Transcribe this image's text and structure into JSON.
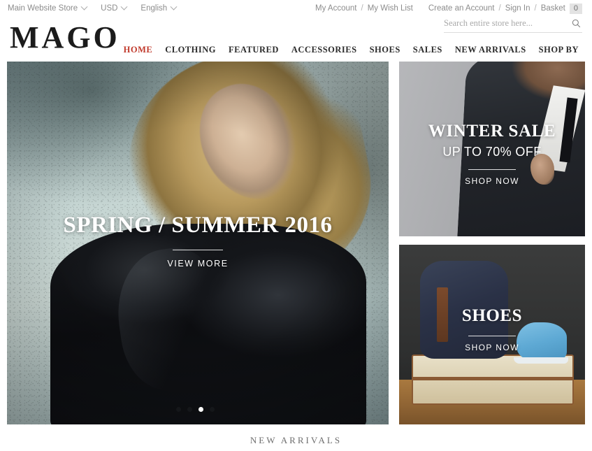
{
  "topbar": {
    "store_switcher": {
      "label": "Main Website Store",
      "icon": "chevron-down-icon"
    },
    "currency_switcher": {
      "label": "USD",
      "icon": "chevron-down-icon"
    },
    "language_switcher": {
      "label": "English",
      "icon": "chevron-down-icon"
    },
    "my_account": "My Account",
    "my_wish_list": "My Wish List",
    "create_account": "Create an Account",
    "sign_in": "Sign In",
    "basket": "Basket",
    "basket_count": "0",
    "separator": "/"
  },
  "header": {
    "logo": "MAGO",
    "search": {
      "placeholder": "Search entire store here...",
      "value": "",
      "icon": "search-icon"
    }
  },
  "nav": {
    "items": [
      {
        "label": "HOME",
        "active": true
      },
      {
        "label": "CLOTHING",
        "active": false
      },
      {
        "label": "FEATURED",
        "active": false
      },
      {
        "label": "ACCESSORIES",
        "active": false
      },
      {
        "label": "SHOES",
        "active": false
      },
      {
        "label": "SALES",
        "active": false
      },
      {
        "label": "NEW ARRIVALS",
        "active": false
      },
      {
        "label": "SHOP BY",
        "active": false
      }
    ],
    "active_color": "#c0392b"
  },
  "hero": {
    "title": "SPRING / SUMMER 2016",
    "cta": "VIEW MORE",
    "slides_total": 4,
    "active_slide": 3
  },
  "promo_top": {
    "title": "WINTER SALE",
    "subtitle": "UP TO 70% OFF",
    "cta": "SHOP NOW"
  },
  "promo_bottom": {
    "title": "SHOES",
    "cta": "SHOP NOW"
  },
  "section": {
    "new_arrivals_heading": "NEW ARRIVALS"
  }
}
